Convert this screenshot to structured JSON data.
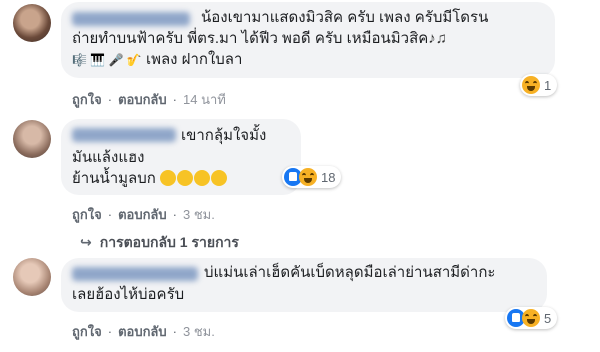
{
  "comments": [
    {
      "lines": [
        "น้องเขามาแสดงมิวสิค ครับ เพลง ครับมีโดรน",
        "ถ่ายทำบนฟ้าครับ พี่ตร.มา ได้ฟีว พอดี ครับ เหมือนมิวสิค",
        "เพลง ฝากใบลา"
      ],
      "line2_suffix": "♪♫",
      "line3_prefix": "🎼 🎹 🎤 🎷",
      "like_label": "ถูกใจ",
      "reply_label": "ตอบกลับ",
      "time": "14 นาที",
      "reaction_count": "1",
      "reactions": [
        "haha"
      ]
    },
    {
      "lines": [
        "เขากลุ้มใจมั้ง",
        "มันแล้งแฮง",
        "ย้านน้ำมูลบก"
      ],
      "emoji_count": 4,
      "like_label": "ถูกใจ",
      "reply_label": "ตอบกลับ",
      "time": "3 ชม.",
      "reaction_count": "18",
      "reactions": [
        "like",
        "haha"
      ],
      "replies_link": "การตอบกลับ 1 รายการ"
    },
    {
      "lines": [
        "บ่แม่นเล่าเฮ็ดคันเบ็ดหลุดมือเล่าย่านสามีด่ากะ",
        "เลยฮ้องไห้บ่อครับ"
      ],
      "like_label": "ถูกใจ",
      "reply_label": "ตอบกลับ",
      "time": "3 ชม.",
      "reaction_count": "5",
      "reactions": [
        "like",
        "haha"
      ]
    }
  ],
  "colors": {
    "bubble": "#f2f3f5",
    "link": "#606770",
    "like_blue": "#1877f2",
    "haha_yellow": "#f7b125"
  }
}
